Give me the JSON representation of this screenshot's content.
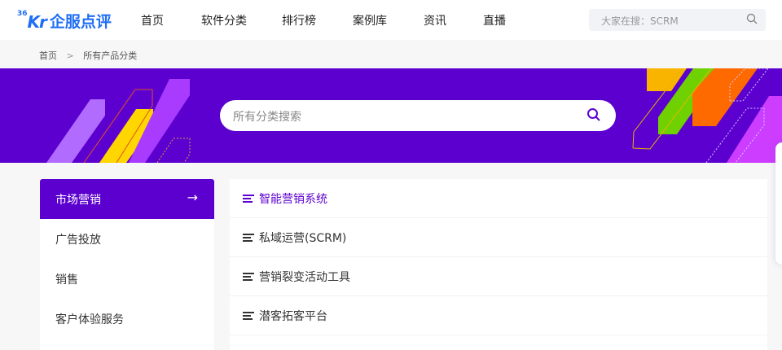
{
  "header": {
    "logo": {
      "sup": "36",
      "k": "Kr",
      "cn": "企服点评"
    },
    "nav": [
      "首页",
      "软件分类",
      "排行榜",
      "案例库",
      "资讯",
      "直播"
    ],
    "search_placeholder": "大家在搜：SCRM"
  },
  "breadcrumb": {
    "home": "首页",
    "sep": ">",
    "current": "所有产品分类"
  },
  "banner": {
    "search_placeholder": "所有分类搜索"
  },
  "sidebar": {
    "items": [
      {
        "label": "市场营销",
        "active": true
      },
      {
        "label": "广告投放"
      },
      {
        "label": "销售"
      },
      {
        "label": "客户体验服务"
      }
    ]
  },
  "subcategories": [
    "智能营销系统",
    "私域运营(SCRM)",
    "营销裂变活动工具",
    "潜客拓客平台"
  ],
  "colors": {
    "accent": "#5c00d0",
    "brand": "#1f6ef6"
  }
}
